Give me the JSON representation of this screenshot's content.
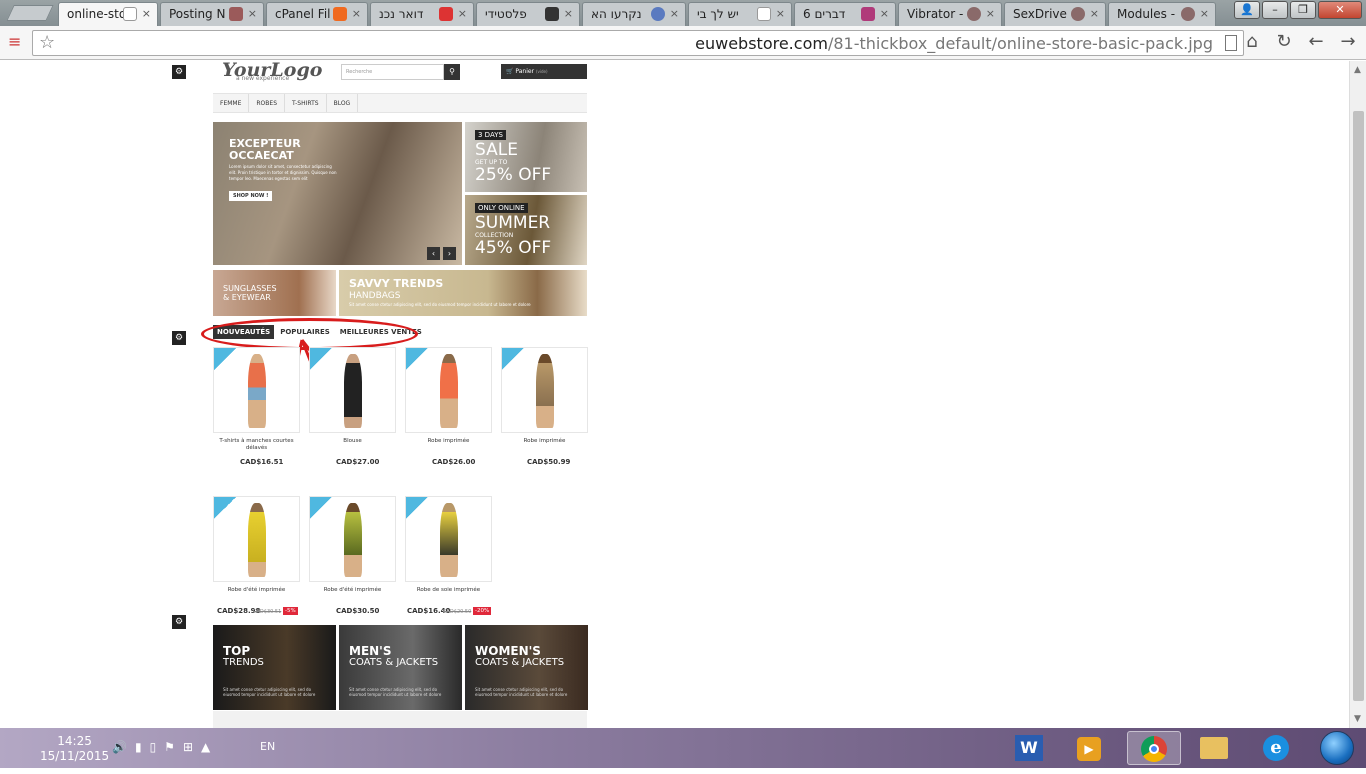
{
  "browser": {
    "tabs": [
      {
        "title": "online-sto",
        "active": true
      },
      {
        "title": "Posting N"
      },
      {
        "title": "cPanel Fil"
      },
      {
        "title": "דואר נכנ"
      },
      {
        "title": "פלסטידי"
      },
      {
        "title": "נקרעו הא"
      },
      {
        "title": "יש לך בי"
      },
      {
        "title": "6 דברים"
      },
      {
        "title": "Vibrator -"
      },
      {
        "title": "SexDrive"
      },
      {
        "title": "Modules -"
      }
    ],
    "url_domain": "euwebstore.com",
    "url_path": "/81-thickbox_default/online-store-basic-pack.jpg",
    "close_glyph": "×",
    "star_glyph": "☆",
    "nav_glyphs": [
      "⌂",
      "↻",
      "←",
      "→"
    ]
  },
  "store": {
    "logo": "YourLogo",
    "tagline": "a new experience",
    "search_placeholder": "Recherche",
    "cart_label": "Panier",
    "cart_sub": "(vide)",
    "nav": [
      "FEMME",
      "ROBES",
      "T-SHIRTS",
      "BLOG"
    ],
    "slider": {
      "title": "EXCEPTEUR OCCAECAT",
      "text": "Lorem ipsum dolor sit amet, consectetur adipiscing elit. Proin tristique in tortor et dignissim. Quisque non tempor leo. Maecenas egestas sem elit",
      "button": "SHOP NOW !"
    },
    "sale": {
      "tag": "3 DAYS",
      "big": "SALE",
      "sub": "GET UP TO",
      "pct": "25% OFF"
    },
    "summer": {
      "tag": "ONLY ONLINE",
      "big": "SUMMER",
      "sub": "COLLECTION",
      "pct": "45% OFF"
    },
    "sunglasses": {
      "line1": "SUNGLASSES",
      "line2": "& EYEWEAR"
    },
    "savvy": {
      "line1": "SAVVY TRENDS",
      "line2": "HANDBAGS",
      "text": "Sit amet conse ctetur adipiscing elit, sed do eiusmod tempor incididunt ut labore et dolore"
    },
    "tabs": [
      "NOUVEAUTÉS",
      "POPULAIRES",
      "MEILLEURES VENTES"
    ],
    "products": [
      {
        "name": "T-shirts à manches courtes délavés",
        "price": "CAD$16.51"
      },
      {
        "name": "Blouse",
        "price": "CAD$27.00"
      },
      {
        "name": "Robe imprimée",
        "price": "CAD$26.00"
      },
      {
        "name": "Robe imprimée",
        "price": "CAD$50.99"
      },
      {
        "name": "Robe d'été imprimée",
        "price": "CAD$28.98",
        "old": "CAD$30.51",
        "disc": "-5%"
      },
      {
        "name": "Robe d'été imprimée",
        "price": "CAD$30.50"
      },
      {
        "name": "Robe de soie imprimée",
        "price": "CAD$16.40",
        "old": "CAD$20.50",
        "disc": "-20%"
      }
    ],
    "promos": [
      {
        "line1": "TOP",
        "line2": "TRENDS",
        "text": "Sit amet conse ctetur adipiscing elit, sed do eiusmod tempor incididunt ut labore et dolore"
      },
      {
        "line1": "MEN'S",
        "line2": "COATS & JACKETS",
        "text": "Sit amet conse ctetur adipiscing elit, sed do eiusmod tempor incididunt ut labore et dolore"
      },
      {
        "line1": "WOMEN'S",
        "line2": "COATS & JACKETS",
        "text": "Sit amet conse ctetur adipiscing elit, sed do eiusmod tempor incididunt ut labore et dolore"
      }
    ]
  },
  "taskbar": {
    "time": "14:25",
    "date": "15/11/2015",
    "language": "EN"
  },
  "colors": {
    "annotation": "#d81c1c",
    "new_badge": "#4fb8e0",
    "discount": "#e0283a"
  }
}
